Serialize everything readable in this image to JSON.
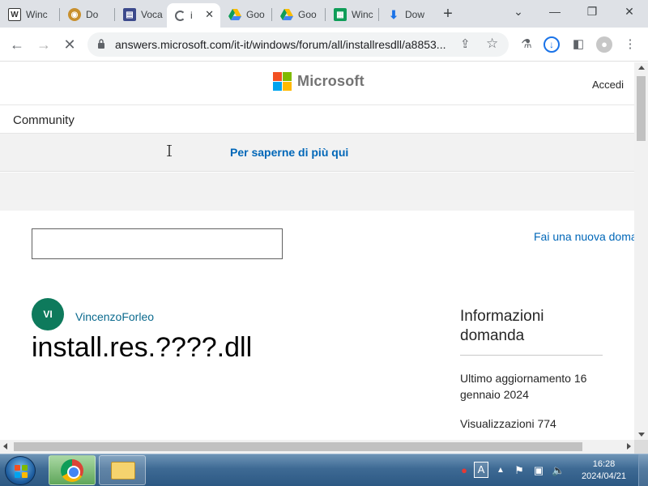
{
  "tabs": [
    {
      "title": "Winc",
      "favicon": "wiki-icon"
    },
    {
      "title": "Do",
      "favicon": "owl-icon"
    },
    {
      "title": "Voca",
      "favicon": "voca-icon"
    },
    {
      "title": "i",
      "favicon": "loading-icon",
      "active": true
    },
    {
      "title": "Goo",
      "favicon": "google-drive-icon"
    },
    {
      "title": "Goo",
      "favicon": "google-drive-icon"
    },
    {
      "title": "Winc",
      "favicon": "sheets-icon"
    },
    {
      "title": "Dow",
      "favicon": "download-icon"
    }
  ],
  "toolbar": {
    "url": "answers.microsoft.com/it-it/windows/forum/all/installresdll/a8853..."
  },
  "header": {
    "brand": "Microsoft",
    "sign_in": "Accedi"
  },
  "community": {
    "label": "Community"
  },
  "banner": {
    "link_text": "Per saperne di più qui"
  },
  "actions": {
    "ask_question": "Fai una nuova doma"
  },
  "question": {
    "author_initials": "VI",
    "author": "VincenzoForleo",
    "title": "install.res.????.dll"
  },
  "sidebar": {
    "heading": "Informazioni domanda",
    "last_updated": "Ultimo aggiornamento 16 gennaio 2024",
    "views": "Visualizzazioni 774"
  },
  "taskbar": {
    "language": "A",
    "time": "16:28",
    "date": "2024/04/21"
  },
  "colors": {
    "link": "#0067b8",
    "avatar": "#0e7a5c",
    "ms_red": "#f25022",
    "ms_green": "#7fba00",
    "ms_blue": "#00a4ef",
    "ms_yellow": "#ffb900"
  }
}
